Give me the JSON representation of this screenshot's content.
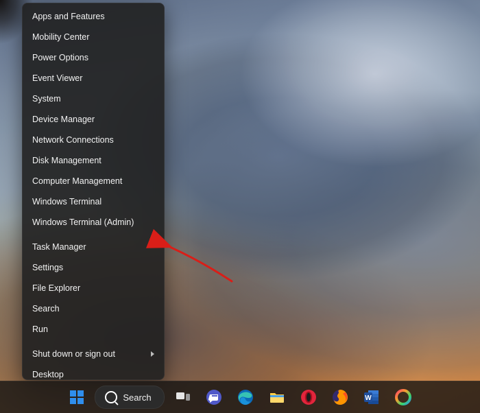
{
  "winx_menu": {
    "group1": [
      "Apps and Features",
      "Mobility Center",
      "Power Options",
      "Event Viewer",
      "System",
      "Device Manager",
      "Network Connections",
      "Disk Management",
      "Computer Management",
      "Windows Terminal",
      "Windows Terminal (Admin)"
    ],
    "group2": [
      "Task Manager",
      "Settings",
      "File Explorer",
      "Search",
      "Run"
    ],
    "group3": [
      {
        "label": "Shut down or sign out",
        "has_submenu": true
      },
      {
        "label": "Desktop",
        "has_submenu": false
      }
    ]
  },
  "taskbar": {
    "search_label": "Search",
    "icons": [
      {
        "id": "start",
        "name": "start-button",
        "title": "Start"
      },
      {
        "id": "search",
        "name": "search-pill",
        "title": "Search"
      },
      {
        "id": "task-view",
        "name": "task-view-button",
        "title": "Task View"
      },
      {
        "id": "chat",
        "name": "chat-button",
        "title": "Chat"
      },
      {
        "id": "edge",
        "name": "edge-browser",
        "title": "Microsoft Edge"
      },
      {
        "id": "explorer",
        "name": "file-explorer",
        "title": "File Explorer"
      },
      {
        "id": "opera",
        "name": "opera-browser",
        "title": "Opera"
      },
      {
        "id": "firefox",
        "name": "firefox-browser",
        "title": "Firefox"
      },
      {
        "id": "word",
        "name": "word-app",
        "title": "Word"
      },
      {
        "id": "generic",
        "name": "app-icon",
        "title": "App"
      }
    ]
  },
  "annotation": {
    "target_item": "Windows Terminal (Admin)",
    "arrow_color": "#d91e18"
  }
}
